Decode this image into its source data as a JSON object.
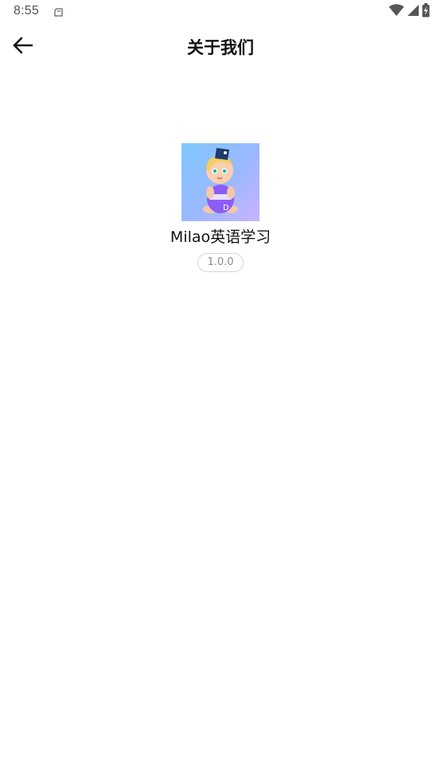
{
  "status_bar": {
    "time": "8:55",
    "icons": [
      "notification-icon",
      "wifi-icon",
      "cell-signal-icon",
      "battery-charging-icon"
    ]
  },
  "toolbar": {
    "title": "关于我们",
    "back_icon": "arrow-left-icon"
  },
  "about": {
    "app_name": "Milao英语学习",
    "version": "1.0.0",
    "icon_colors": {
      "bg_start": "#7fc7ff",
      "bg_end": "#c9b3ff",
      "outfit": "#8b5cf6",
      "hat": "#1e3a6e"
    }
  }
}
